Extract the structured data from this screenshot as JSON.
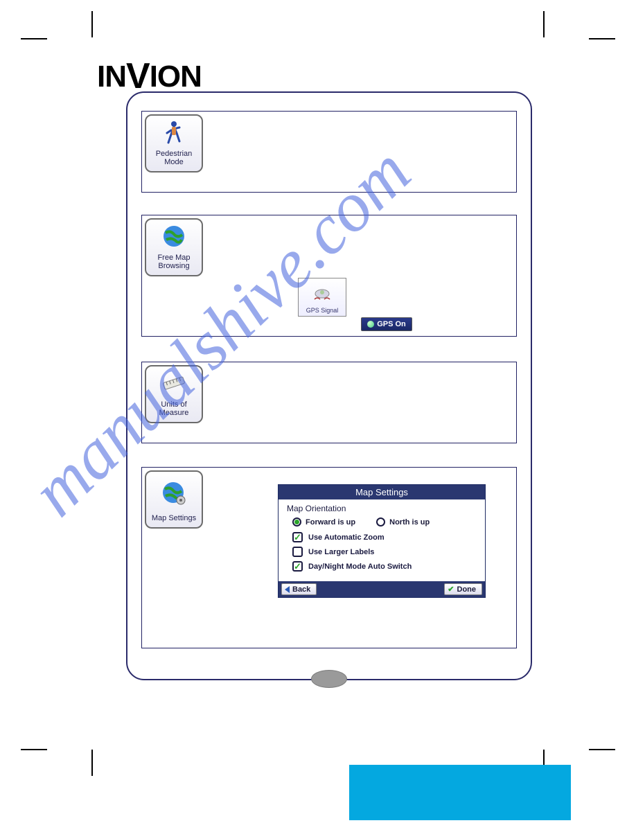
{
  "brand": "INVION",
  "watermark": "manualshive.com",
  "rows": {
    "pedestrian": {
      "label": "Pedestrian\nMode"
    },
    "freemap": {
      "label": "Free Map\nBrowsing",
      "gps_signal_label": "GPS Signal",
      "gps_on_label": "GPS On"
    },
    "units": {
      "label": "Units of\nMeasure"
    },
    "mapsettings": {
      "label": "Map Settings"
    }
  },
  "dialog": {
    "title": "Map Settings",
    "subtitle": "Map Orientation",
    "radio_forward": "Forward is up",
    "radio_north": "North is up",
    "chk_zoom": "Use Automatic Zoom",
    "chk_labels": "Use Larger Labels",
    "chk_daynight": "Day/Night Mode Auto Switch",
    "btn_back": "Back",
    "btn_done": "Done"
  }
}
